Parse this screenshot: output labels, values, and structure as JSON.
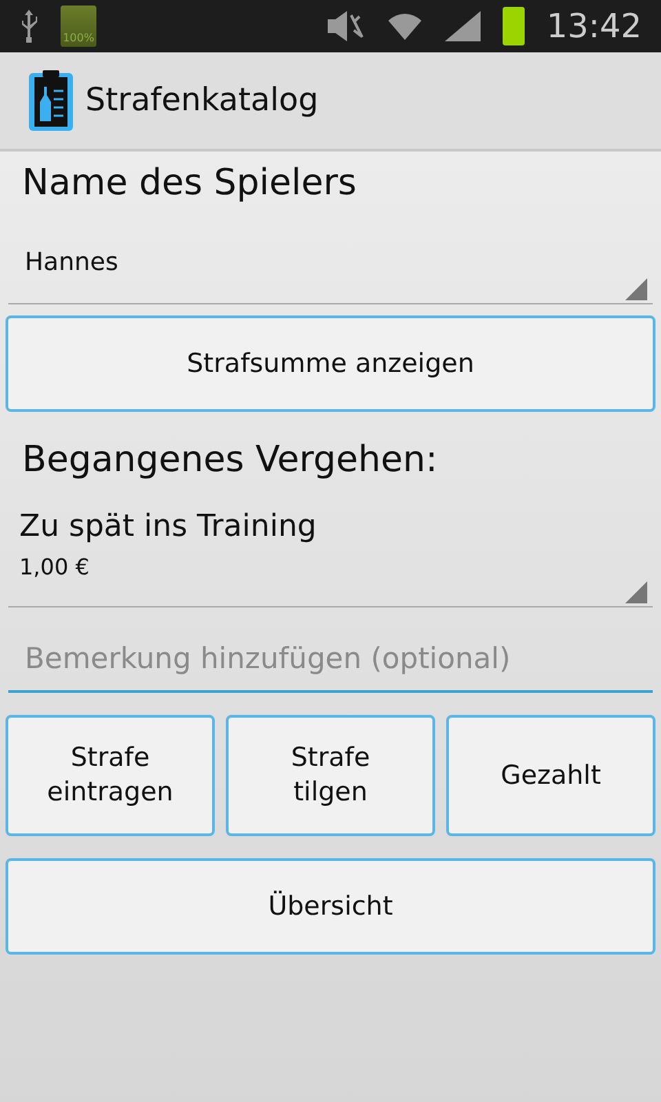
{
  "status_bar": {
    "battery_label": "100%",
    "time": "13:42"
  },
  "action_bar": {
    "title": "Strafenkatalog"
  },
  "player": {
    "heading": "Name des Spielers",
    "value": "Hannes"
  },
  "sum_button": "Strafsumme anzeigen",
  "offense": {
    "heading": "Begangenes Vergehen:",
    "value": "Zu spät ins Training",
    "amount": "1,00 €"
  },
  "remark": {
    "placeholder": "Bemerkung hinzufügen (optional)",
    "focused": true
  },
  "action_buttons": [
    "Strafe eintragen",
    "Strafe tilgen",
    "Gezahlt"
  ],
  "overview_button": "Übersicht"
}
